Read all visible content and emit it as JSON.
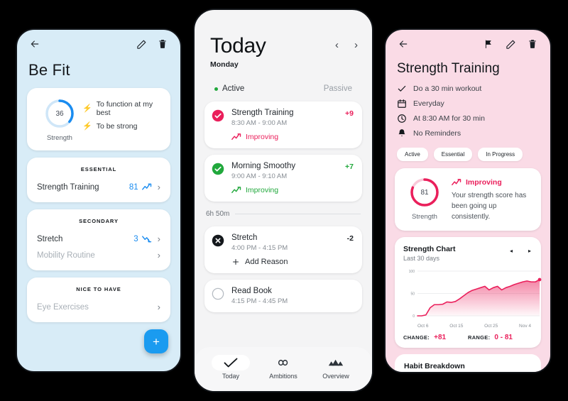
{
  "colors": {
    "blue": "#1a8cf0",
    "blue_track": "#cfe6f8",
    "pink": "#ea1f5b",
    "pink_track": "#f9c9d9",
    "green": "#21a83c",
    "left_bg": "#d8ecf7",
    "mid_bg": "#f4f4f5",
    "right_bg": "#fadbe6",
    "fab": "#1a9bf0"
  },
  "left": {
    "appbar": {
      "back": "←",
      "edit_icon": "pencil-icon",
      "delete_icon": "trash-icon"
    },
    "title": "Be Fit",
    "score": {
      "value": "36",
      "percent": 36,
      "label": "Strength",
      "reasons": [
        "To function at my best",
        "To be strong"
      ]
    },
    "sections": [
      {
        "heading": "ESSENTIAL",
        "rows": [
          {
            "name": "Strength Training",
            "value": "81",
            "trend": "up",
            "muted": false
          }
        ]
      },
      {
        "heading": "SECONDARY",
        "rows": [
          {
            "name": "Stretch",
            "value": "3",
            "trend": "down",
            "muted": false
          },
          {
            "name": "Mobility Routine",
            "value": "",
            "trend": "none",
            "muted": true
          }
        ]
      },
      {
        "heading": "NICE TO HAVE",
        "rows": [
          {
            "name": "Eye Exercises",
            "value": "",
            "trend": "none",
            "muted": true
          }
        ]
      }
    ],
    "fab_label": "+"
  },
  "mid": {
    "title": "Today",
    "weekday": "Monday",
    "prev_arrow": "‹",
    "next_arrow": "›",
    "filters": {
      "active": "Active",
      "passive": "Passive"
    },
    "tasks_top": [
      {
        "name": "Strength Training",
        "time": "8:30 AM - 9:00 AM",
        "delta": "+9",
        "delta_color": "pink",
        "status": "done-pink",
        "trend_label": "Improving",
        "trend_color": "pink"
      },
      {
        "name": "Morning Smoothy",
        "time": "9:00 AM - 9:10 AM",
        "delta": "+7",
        "delta_color": "green",
        "status": "done-green",
        "trend_label": "Improving",
        "trend_color": "green"
      }
    ],
    "gap_label": "6h 50m",
    "tasks_bottom": [
      {
        "name": "Stretch",
        "time": "4:00 PM - 4:15 PM",
        "delta": "-2",
        "delta_color": "dark",
        "status": "failed",
        "action_label": "Add Reason"
      },
      {
        "name": "Read Book",
        "time": "4:15 PM - 4:45 PM",
        "delta": "",
        "delta_color": "dark",
        "status": "pending",
        "action_label": ""
      }
    ],
    "nav": [
      {
        "label": "Today",
        "icon": "check-icon",
        "selected": true
      },
      {
        "label": "Ambitions",
        "icon": "infinity-icon",
        "selected": false
      },
      {
        "label": "Overview",
        "icon": "mountains-icon",
        "selected": false
      }
    ]
  },
  "right": {
    "appbar": {
      "back": "←",
      "flag_icon": "flag-icon",
      "edit_icon": "pencil-icon",
      "delete_icon": "trash-icon"
    },
    "title": "Strength Training",
    "meta": [
      {
        "icon": "check-icon",
        "text": "Do a 30 min workout"
      },
      {
        "icon": "calendar-icon",
        "text": "Everyday"
      },
      {
        "icon": "clock-icon",
        "text": "At 8:30 AM for 30 min"
      },
      {
        "icon": "bell-icon",
        "text": "No Reminders"
      }
    ],
    "chips": [
      "Active",
      "Essential",
      "In Progress"
    ],
    "score": {
      "value": "81",
      "percent": 81,
      "label": "Strength",
      "trend_label": "Improving",
      "description": "Your strength score has been going up consistently."
    },
    "breakdown_title": "Habit Breakdown"
  },
  "chart_data": {
    "type": "area",
    "title": "Strength Chart",
    "subtitle": "Last 30 days",
    "xlabel": "",
    "ylabel": "",
    "ylim": [
      0,
      100
    ],
    "yticks": [
      0,
      50,
      100
    ],
    "ytick_labels": [
      "0",
      "50",
      "100"
    ],
    "xtick_labels": [
      "Oct 6",
      "Oct 15",
      "Oct 25",
      "Nov 4"
    ],
    "grid": true,
    "legend": "none",
    "x": [
      "Oct 6",
      "Oct 7",
      "Oct 8",
      "Oct 9",
      "Oct 10",
      "Oct 11",
      "Oct 12",
      "Oct 13",
      "Oct 14",
      "Oct 15",
      "Oct 16",
      "Oct 17",
      "Oct 18",
      "Oct 19",
      "Oct 20",
      "Oct 21",
      "Oct 22",
      "Oct 23",
      "Oct 24",
      "Oct 25",
      "Oct 26",
      "Oct 27",
      "Oct 28",
      "Oct 29",
      "Oct 30",
      "Oct 31",
      "Nov 1",
      "Nov 2",
      "Nov 3",
      "Nov 4"
    ],
    "values": [
      0,
      0,
      2,
      18,
      25,
      25,
      26,
      31,
      30,
      32,
      38,
      45,
      52,
      57,
      60,
      63,
      66,
      58,
      63,
      66,
      58,
      63,
      66,
      70,
      73,
      76,
      78,
      76,
      76,
      81
    ],
    "last_point": 81,
    "stats": [
      {
        "key": "CHANGE:",
        "value": "+81"
      },
      {
        "key": "RANGE:",
        "value": "0 - 81"
      }
    ]
  }
}
